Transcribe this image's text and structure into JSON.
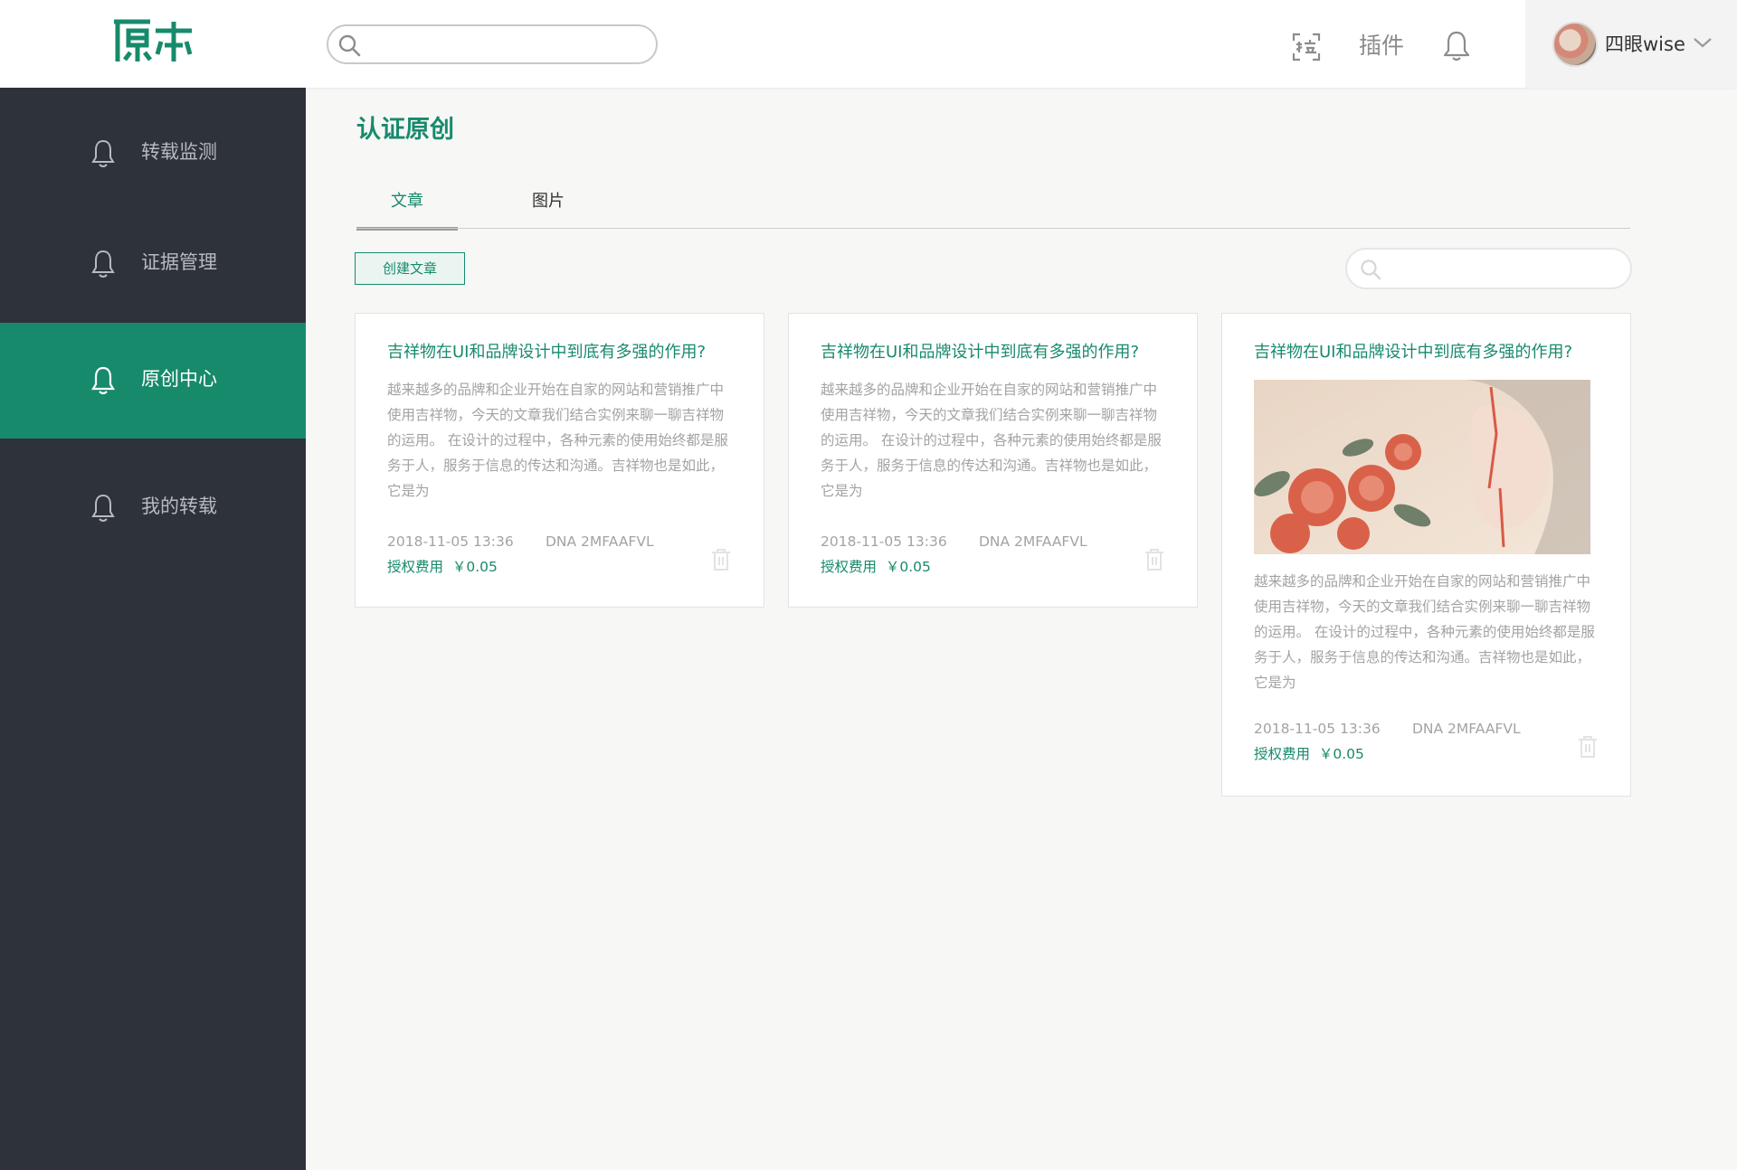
{
  "header": {
    "logo_text": "原本",
    "search_placeholder": "",
    "plugin_label": "插件",
    "user_name": "四眼wise"
  },
  "sidebar": {
    "items": [
      {
        "label": "转载监测",
        "active": false
      },
      {
        "label": "证据管理",
        "active": false
      },
      {
        "label": "原创中心",
        "active": true
      },
      {
        "label": "我的转载",
        "active": false
      }
    ]
  },
  "main": {
    "title": "认证原创",
    "tabs": [
      {
        "label": "文章",
        "active": true
      },
      {
        "label": "图片",
        "active": false
      }
    ],
    "create_button": "创建文章",
    "list_search_placeholder": "",
    "cards": [
      {
        "title": "吉祥物在UI和品牌设计中到底有多强的作用?",
        "excerpt": "越来越多的品牌和企业开始在自家的网站和营销推广中使用吉祥物，今天的文章我们结合实例来聊一聊吉祥物的运用。 在设计的过程中，各种元素的使用始终都是服务于人，服务于信息的传达和沟通。吉祥物也是如此，它是为",
        "date": "2018-11-05 13:36",
        "dna": "DNA 2MFAAFVL",
        "fee_label": "授权费用",
        "fee_value": "￥0.05",
        "has_image": false
      },
      {
        "title": "吉祥物在UI和品牌设计中到底有多强的作用?",
        "excerpt": "越来越多的品牌和企业开始在自家的网站和营销推广中使用吉祥物，今天的文章我们结合实例来聊一聊吉祥物的运用。 在设计的过程中，各种元素的使用始终都是服务于人，服务于信息的传达和沟通。吉祥物也是如此，它是为",
        "date": "2018-11-05 13:36",
        "dna": "DNA 2MFAAFVL",
        "fee_label": "授权费用",
        "fee_value": "￥0.05",
        "has_image": false
      },
      {
        "title": "吉祥物在UI和品牌设计中到底有多强的作用?",
        "excerpt": "越来越多的品牌和企业开始在自家的网站和营销推广中使用吉祥物，今天的文章我们结合实例来聊一聊吉祥物的运用。 在设计的过程中，各种元素的使用始终都是服务于人，服务于信息的传达和沟通。吉祥物也是如此，它是为",
        "date": "2018-11-05 13:36",
        "dna": "DNA 2MFAAFVL",
        "fee_label": "授权费用",
        "fee_value": "￥0.05",
        "has_image": true
      }
    ]
  },
  "colors": {
    "brand": "#188a6c",
    "sidebar_bg": "#2e323a",
    "page_bg": "#f7f7f6"
  }
}
